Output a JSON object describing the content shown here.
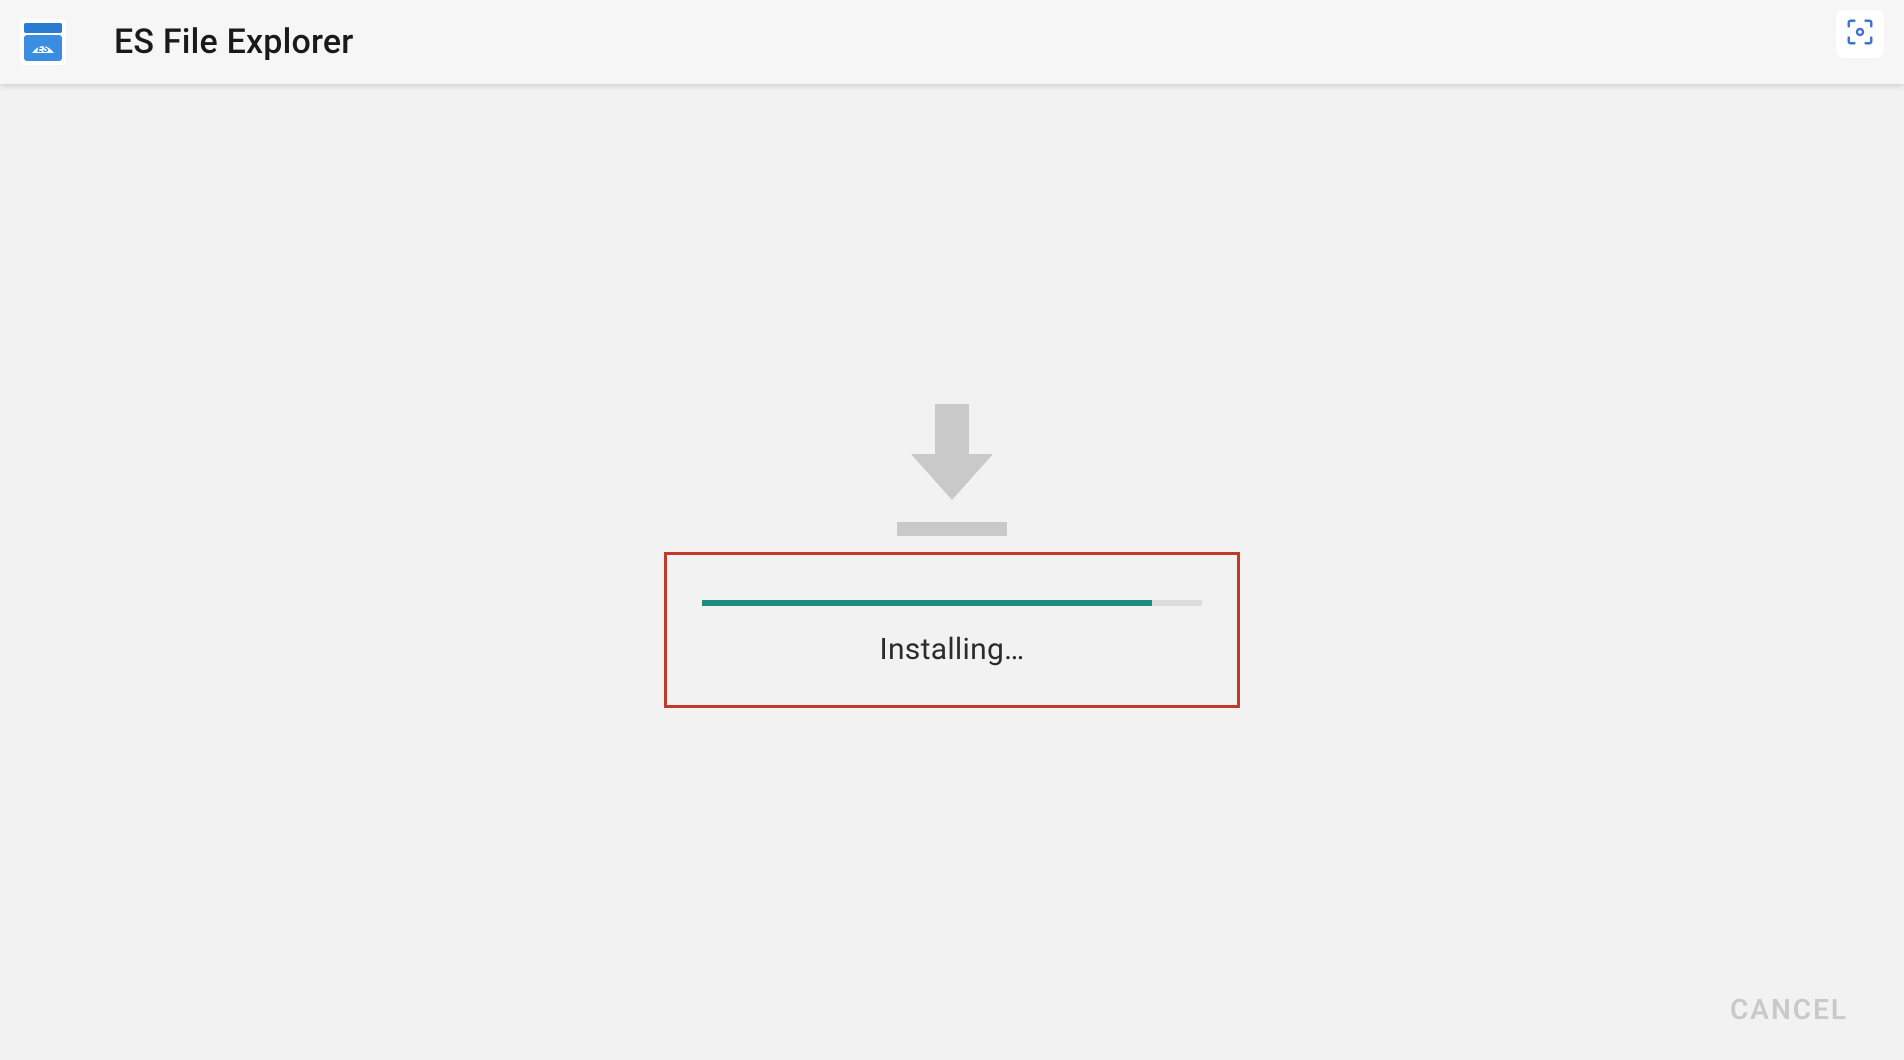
{
  "header": {
    "app_title": "ES File Explorer",
    "app_icon": "es-file-explorer-icon",
    "corner_action_icon": "screenshot-icon"
  },
  "install": {
    "download_icon": "download-arrow-icon",
    "status_text": "Installing…",
    "progress_percent": 90,
    "progress_color": "#1e8e7e",
    "highlight_border_color": "#c0392b"
  },
  "footer": {
    "cancel_label": "CANCEL"
  }
}
